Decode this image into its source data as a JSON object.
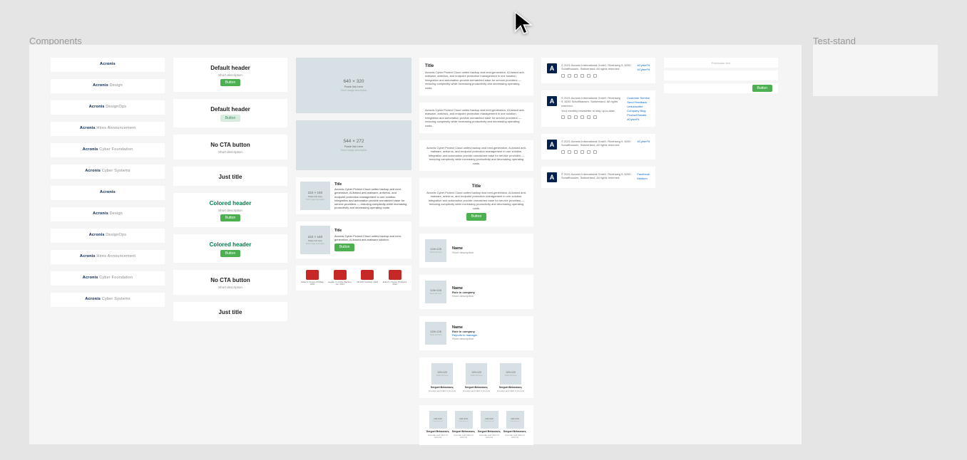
{
  "titles": {
    "components": "Components",
    "teststand": "Test-stand"
  },
  "acronis_rows": [
    {
      "b1": "Acronis",
      "b2": ""
    },
    {
      "b1": "Acronis",
      "b2": "Design"
    },
    {
      "b1": "Acronis",
      "b2": "DesignOps"
    },
    {
      "b1": "Acronis",
      "b2": "Hires Announcement"
    },
    {
      "b1": "Acronis",
      "b2": "Cyber Foundation"
    },
    {
      "b1": "Acronis",
      "b2": "Cyber Systems"
    },
    {
      "b1": "Acronis",
      "b2": ""
    },
    {
      "b1": "Acronis",
      "b2": "Design"
    },
    {
      "b1": "Acronis",
      "b2": "DesignOps"
    },
    {
      "b1": "Acronis",
      "b2": "Hires Announcement"
    },
    {
      "b1": "Acronis",
      "b2": "Cyber Foundation"
    },
    {
      "b1": "Acronis",
      "b2": "Cyber Systems"
    }
  ],
  "header_cards": [
    {
      "title": "Default header",
      "desc": "Short description",
      "btn": "Button",
      "colored": false,
      "btn_style": "solid"
    },
    {
      "title": "Default header",
      "desc": "",
      "btn": "Button",
      "colored": false,
      "btn_style": "light"
    },
    {
      "title": "No CTA button",
      "desc": "Short description",
      "btn": "",
      "colored": false
    },
    {
      "title": "Just title",
      "desc": "",
      "btn": "",
      "colored": false
    },
    {
      "title": "Colored header",
      "desc": "Short description",
      "btn": "Button",
      "colored": true,
      "btn_style": "solid"
    },
    {
      "title": "Colored header",
      "desc": "",
      "btn": "Button",
      "colored": true,
      "btn_style": "solid"
    },
    {
      "title": "No CTA button",
      "desc": "Short description",
      "btn": "",
      "colored": false
    },
    {
      "title": "Just title",
      "desc": "",
      "btn": "",
      "colored": false
    }
  ],
  "placeholders": {
    "big": {
      "dim": "640 × 320",
      "link": "Paste link here",
      "sub": "Short image description"
    },
    "med": {
      "dim": "544 × 272",
      "link": "Paste link here",
      "sub": "Short image description"
    },
    "mini": {
      "dim": "224 × 160",
      "link": "Paste link here",
      "sub": "Short image description"
    }
  },
  "col3_items": [
    {
      "title": "Title",
      "body": "Acronis Cyber Protect Cloud unites backup and next-generation, AI-based anti-malware, antivirus, and endpoint protection management in one solution. Integration and automation provide unmatched ease for service providers — reducing complexity while increasing productivity and decreasing operating costs."
    },
    {
      "title": "Title",
      "body": "Acronis Cyber Protect Cloud unites backup and next-generation, AI-based anti-malware solution.",
      "btn": "Button"
    }
  ],
  "awards": [
    {
      "label": "Editor's Choice PCMag, 2021"
    },
    {
      "label": "Leader in Online Backup, G2, 2021"
    },
    {
      "label": "VB 100 Certified, 2021"
    },
    {
      "label": "Editor's Choice PCWorld, 2021"
    }
  ],
  "lorem": "Acronis Cyber Protect Cloud unites backup and next-generation, AI-based anti-malware, antivirus, and endpoint protection management in one solution. Integration and automation provide unmatched ease for service providers — reducing complexity while increasing productivity and decreasing operating costs.",
  "lorem_short": "Acronis Cyber Protect Cloud unites backup and next-generation, AI-based anti-malware, antivirus, and endpoint protection management in one solution. Integration and automation provide unmatched ease for service providers — reducing complexity while increasing productivity and decreasing operating costs.",
  "col4_text": {
    "t1": "Title",
    "t2": "Title",
    "btn": "Button"
  },
  "persons": [
    {
      "name": "Name",
      "desc": "Short description"
    },
    {
      "name": "Name",
      "role": "Role in company",
      "desc": "Short description"
    },
    {
      "name": "Name",
      "role": "Role in company",
      "reports": "Reports to manager",
      "desc": "Short description"
    }
  ],
  "person_av": {
    "dim": "128×128",
    "sub": "Paste link here"
  },
  "grid3": {
    "av": {
      "dim": "120×120",
      "sub": "Paste link here"
    },
    "name": "Serguei Beloussov,",
    "role": "Founder and CEO of Acronis"
  },
  "grid4": {
    "av": {
      "dim": "120×120",
      "sub": "Paste link here"
    },
    "name": "Serguei Beloussov,",
    "role": "Founder and CEO of Acronis"
  },
  "footer": {
    "copy": "© 2021 Acronis International GmbH. Rheinweg 9, 8200 Schaffhausen, Switzerland. All rights reserved.",
    "extra": "Your monthly newsletter to stay up-to-date.",
    "link_sets": {
      "a": [
        "#CyberFit",
        "#CyberFit"
      ],
      "b": [
        "Customer Service",
        "Send Feedback",
        "Unsubscribe",
        "Company Blog",
        "Product Details",
        "#CyberFit"
      ],
      "c": [
        "#CyberFit"
      ],
      "d": [
        "Facebook",
        "Medium"
      ]
    }
  },
  "col6": {
    "placeholder": "Preheader text",
    "btn": "Button"
  }
}
